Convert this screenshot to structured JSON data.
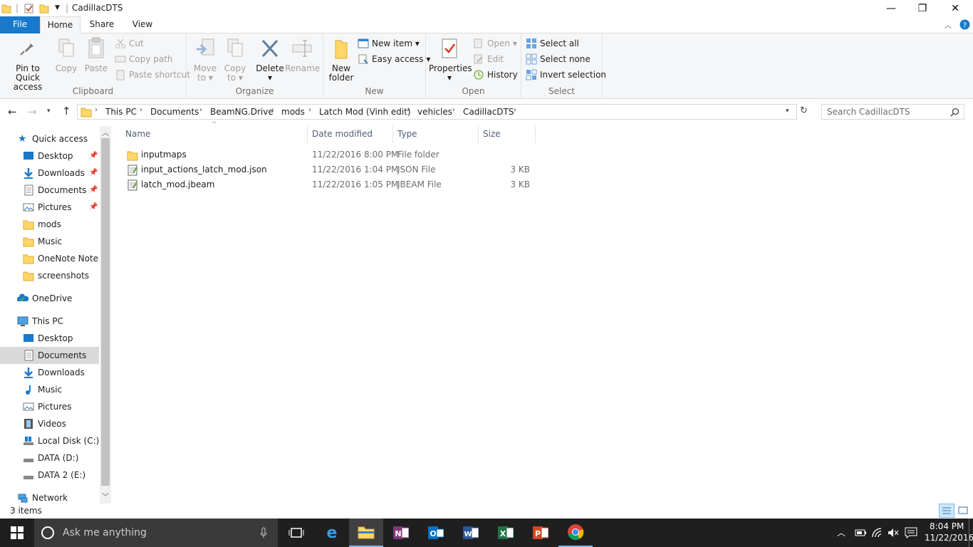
{
  "window": {
    "title": "CadillacDTS",
    "min_glyph": "—",
    "max_glyph": "❐",
    "close_glyph": "✕"
  },
  "tabs": {
    "file": "File",
    "home": "Home",
    "share": "Share",
    "view": "View"
  },
  "ribbon": {
    "clipboard": {
      "label": "Clipboard",
      "pin_line1": "Pin to Quick",
      "pin_line2": "access",
      "copy": "Copy",
      "paste": "Paste",
      "cut": "Cut",
      "copy_path": "Copy path",
      "paste_shortcut": "Paste shortcut"
    },
    "organize": {
      "label": "Organize",
      "move_line1": "Move",
      "move_line2": "to",
      "copy_line1": "Copy",
      "copy_line2": "to",
      "delete": "Delete",
      "rename": "Rename"
    },
    "new": {
      "label": "New",
      "new_folder_line1": "New",
      "new_folder_line2": "folder",
      "new_item": "New item",
      "easy_access": "Easy access"
    },
    "open": {
      "label": "Open",
      "properties": "Properties",
      "open": "Open",
      "edit": "Edit",
      "history": "History"
    },
    "select": {
      "label": "Select",
      "select_all": "Select all",
      "select_none": "Select none",
      "invert_selection": "Invert selection"
    }
  },
  "address": {
    "crumbs": [
      "This PC",
      "Documents",
      "BeamNG.Drive",
      "mods",
      "Latch Mod (Vinh edit)",
      "vehicles",
      "CadillacDTS"
    ],
    "search_placeholder": "Search CadillacDTS"
  },
  "nav": {
    "quick_access": "Quick access",
    "qa_items": [
      "Desktop",
      "Downloads",
      "Documents",
      "Pictures",
      "mods",
      "Music",
      "OneNote Notebooks",
      "screenshots"
    ],
    "onedrive": "OneDrive",
    "this_pc": "This PC",
    "pc_items": [
      "Desktop",
      "Documents",
      "Downloads",
      "Music",
      "Pictures",
      "Videos",
      "Local Disk (C:)",
      "DATA (D:)",
      "DATA 2 (E:)"
    ],
    "network": "Network"
  },
  "columns": {
    "name": "Name",
    "date": "Date modified",
    "type": "Type",
    "size": "Size"
  },
  "files": [
    {
      "name": "inputmaps",
      "date": "11/22/2016 8:00 PM",
      "type": "File folder",
      "size": ""
    },
    {
      "name": "input_actions_latch_mod.json",
      "date": "11/22/2016 1:04 PM",
      "type": "JSON File",
      "size": "3 KB"
    },
    {
      "name": "latch_mod.jbeam",
      "date": "11/22/2016 1:05 PM",
      "type": "JBEAM File",
      "size": "3 KB"
    }
  ],
  "status": {
    "items": "3 items"
  },
  "taskbar": {
    "search_placeholder": "Ask me anything",
    "time": "8:04 PM",
    "date": "11/22/2016"
  },
  "colors": {
    "accent": "#1979ca",
    "folder": "#ffd766",
    "taskbar": "#1f1f1f",
    "selected": "#cce8ff"
  }
}
